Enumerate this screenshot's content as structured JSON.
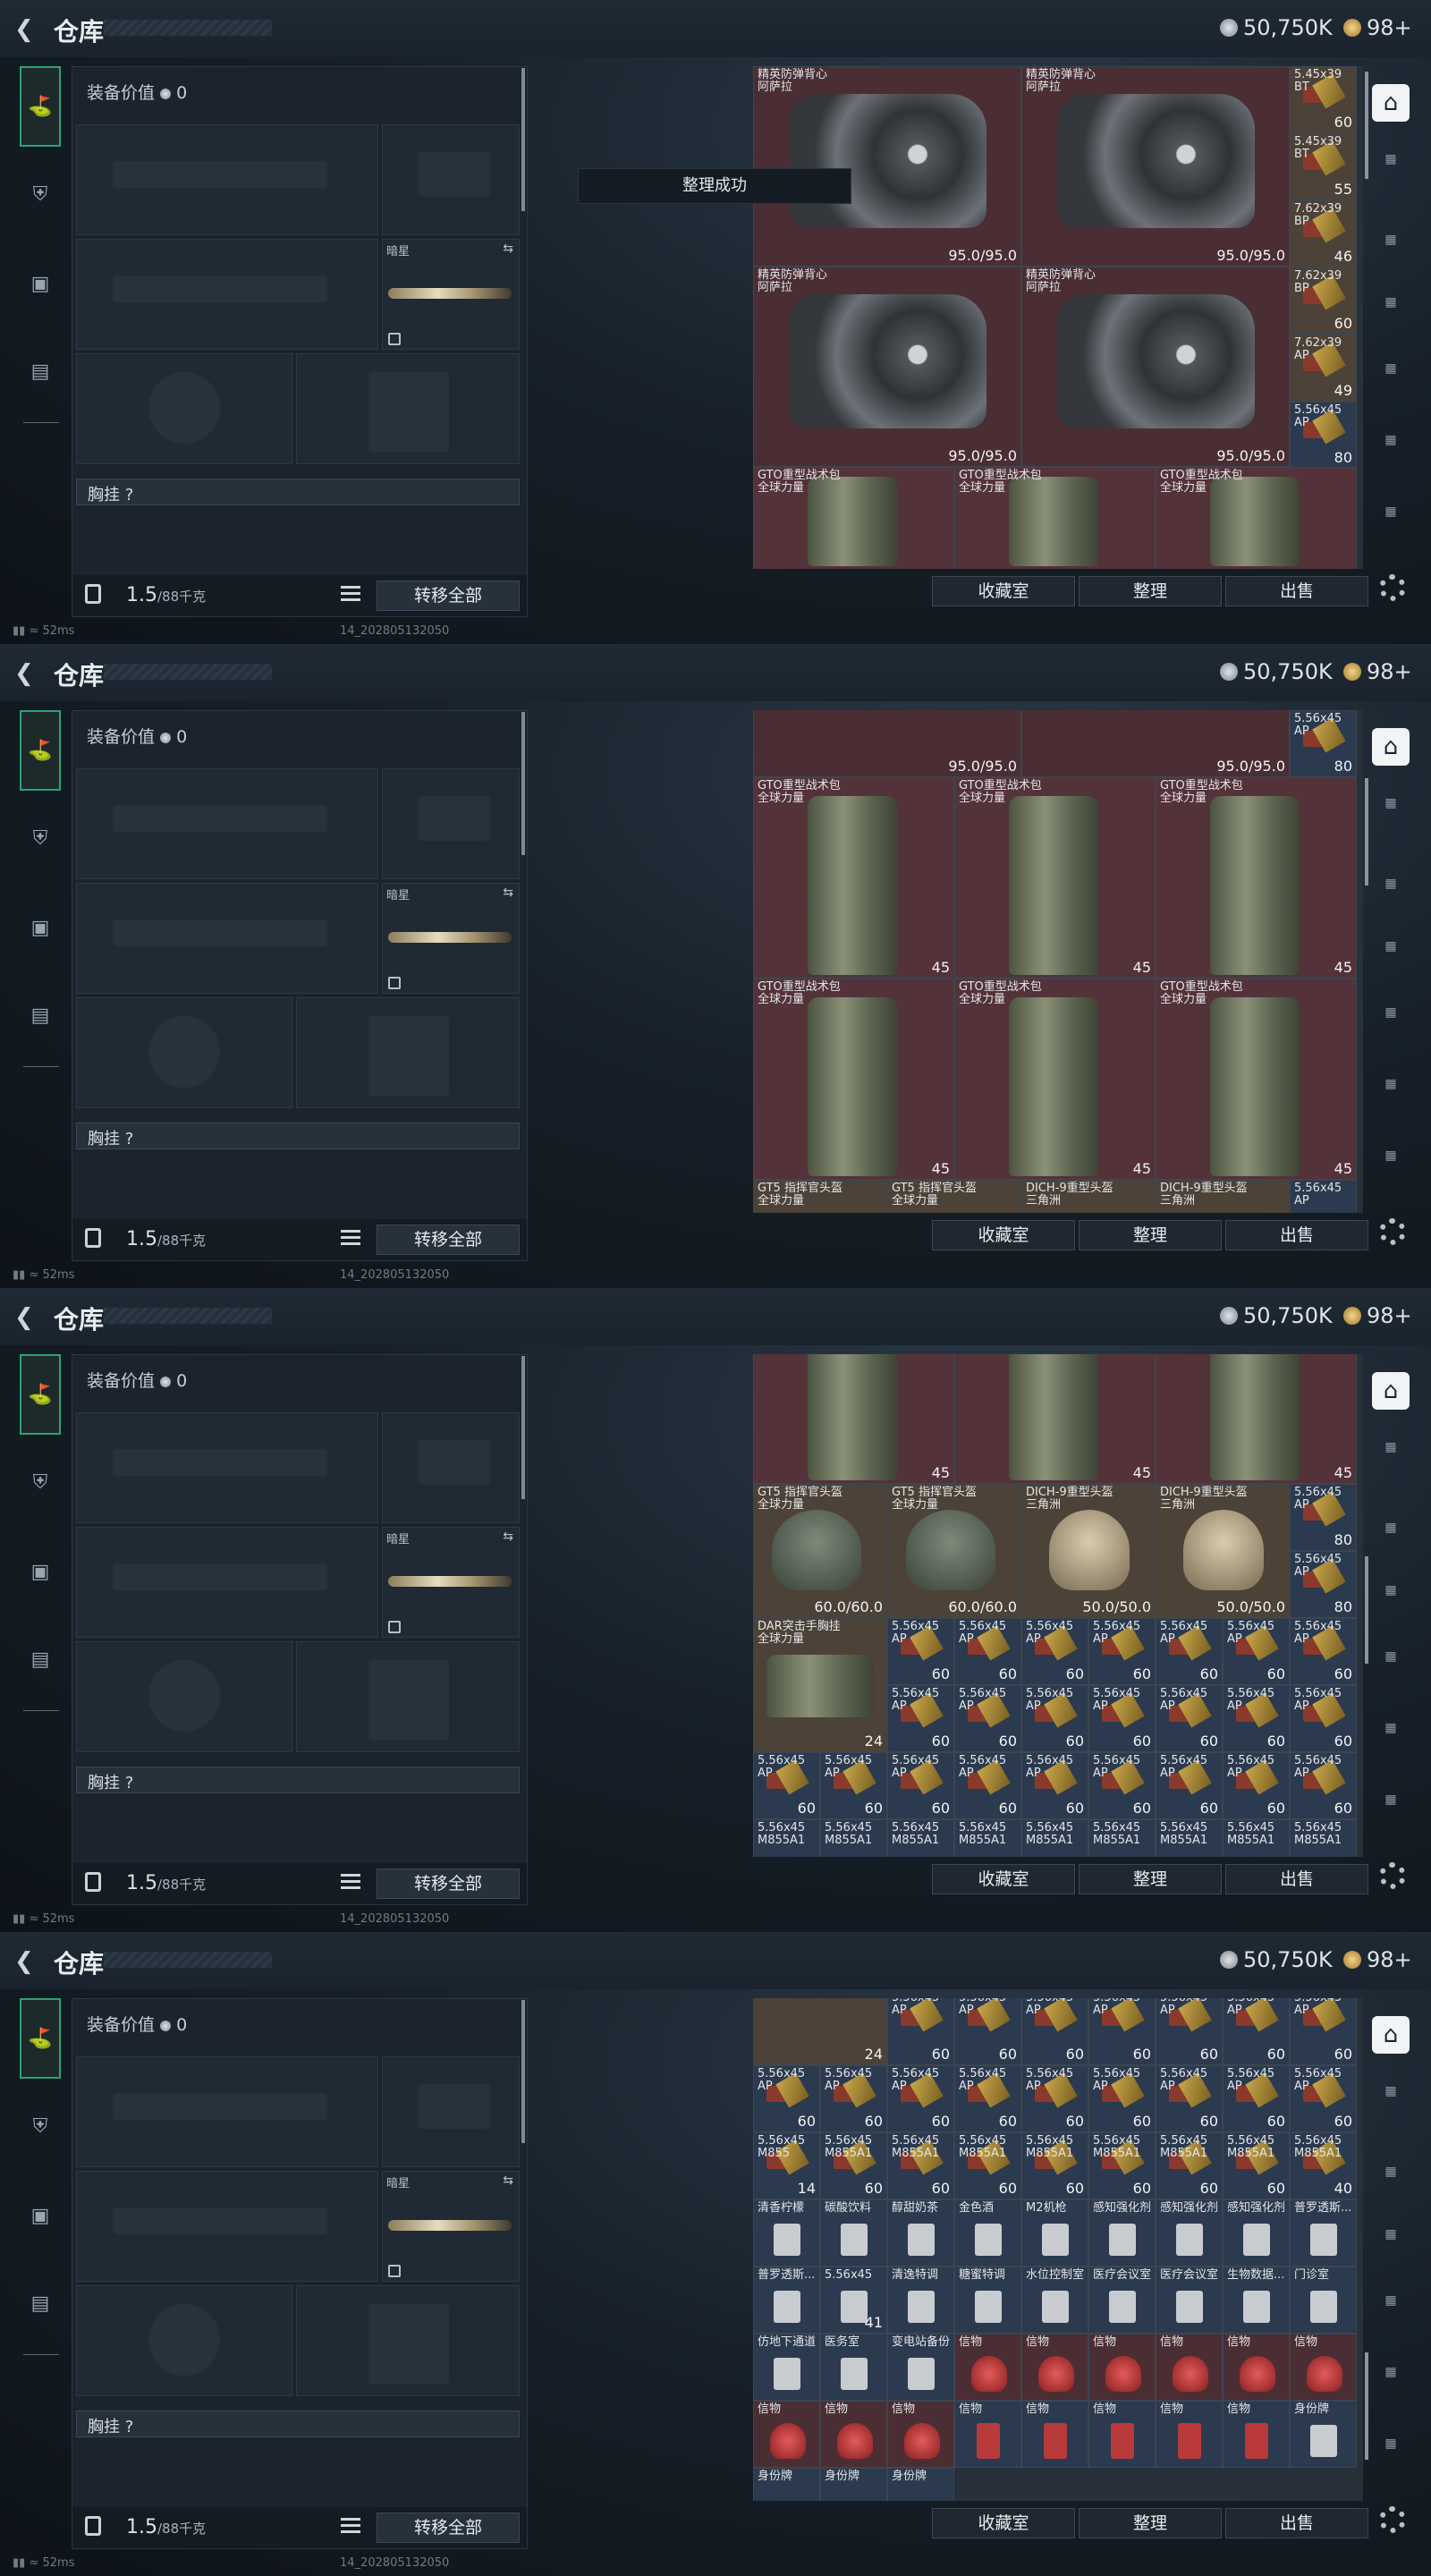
{
  "header": {
    "back": "<",
    "title": "仓库",
    "currency_silver": "50,750K",
    "currency_gold": "98+"
  },
  "left": {
    "equip_value_label": "装备价值",
    "equip_value": "0",
    "melee_label": "暗星",
    "chest_label": "胸挂",
    "chest_hint": "?",
    "weight": "1.5",
    "weight_max": "/88千克",
    "transfer_all": "转移全部"
  },
  "toast": "整理成功",
  "buttons": {
    "collection": "收藏室",
    "sort": "整理",
    "sell": "出售"
  },
  "status": {
    "ping": "52ms",
    "build": "14_202805132050"
  },
  "items": {
    "vest": {
      "name": "精英防弹背心\n阿萨拉",
      "dur": "95.0/95.0"
    },
    "bag": {
      "name": "GTO重型战术包\n全球力量",
      "count": "45"
    },
    "gt5": {
      "name": "GT5 指挥官头盔\n全球力量",
      "dur": "60.0/60.0"
    },
    "dich": {
      "name": "DICH-9重型头盔\n三角洲",
      "dur": "50.0/50.0"
    },
    "dar": {
      "name": "DAR突击手胸挂\n全球力量",
      "count": "24"
    },
    "ammo556": {
      "name": "5.56x45\nAP",
      "count": "60"
    },
    "ammo556m": {
      "name": "5.56x45\nM855A1",
      "count": "60"
    },
    "ammo545": {
      "name": "5.45x39\nBT",
      "count": "60"
    },
    "ammo545b": {
      "name": "5.45x39\nBT",
      "count": "55"
    },
    "ammo762": {
      "name": "7.62x39\nBP",
      "count": "46"
    },
    "ammo762b": {
      "name": "7.62x39\nBP",
      "count": "60"
    },
    "ammo762c": {
      "name": "7.62x39\nAP",
      "count": "49"
    },
    "ammo556ap": {
      "name": "5.56x45\nAP",
      "count": "80"
    },
    "ammo14": {
      "name": "5.56x45\nM855",
      "count": "14"
    },
    "ammo40": {
      "name": "5.56x45\nM855A1",
      "count": "40"
    },
    "ammo41": {
      "name": "5.56x45\nM855",
      "count": "41"
    },
    "misc": [
      "清香柠檬",
      "碳酸饮料",
      "醇甜奶茶",
      "金色酒",
      "M2机枪",
      "感知强化剂",
      "感知强化剂",
      "感知强化剂",
      "普罗透斯..."
    ],
    "misc2": [
      "普罗透斯...",
      "5.56x45",
      "清逸特调",
      "糖蜜特调",
      "水位控制室",
      "医疗会议室",
      "医疗会议室",
      "生物数据...",
      "门诊室"
    ],
    "misc3": [
      "仿地下通道",
      "医务室",
      "变电站备份",
      "信物",
      "信物",
      "信物",
      "信物",
      "信物",
      "信物"
    ],
    "misc4": [
      "信物",
      "信物",
      "信物",
      "信物",
      "信物",
      "信物",
      "信物",
      "信物",
      "身份牌"
    ],
    "misc5": [
      "身份牌",
      "身份牌",
      "身份牌"
    ]
  }
}
